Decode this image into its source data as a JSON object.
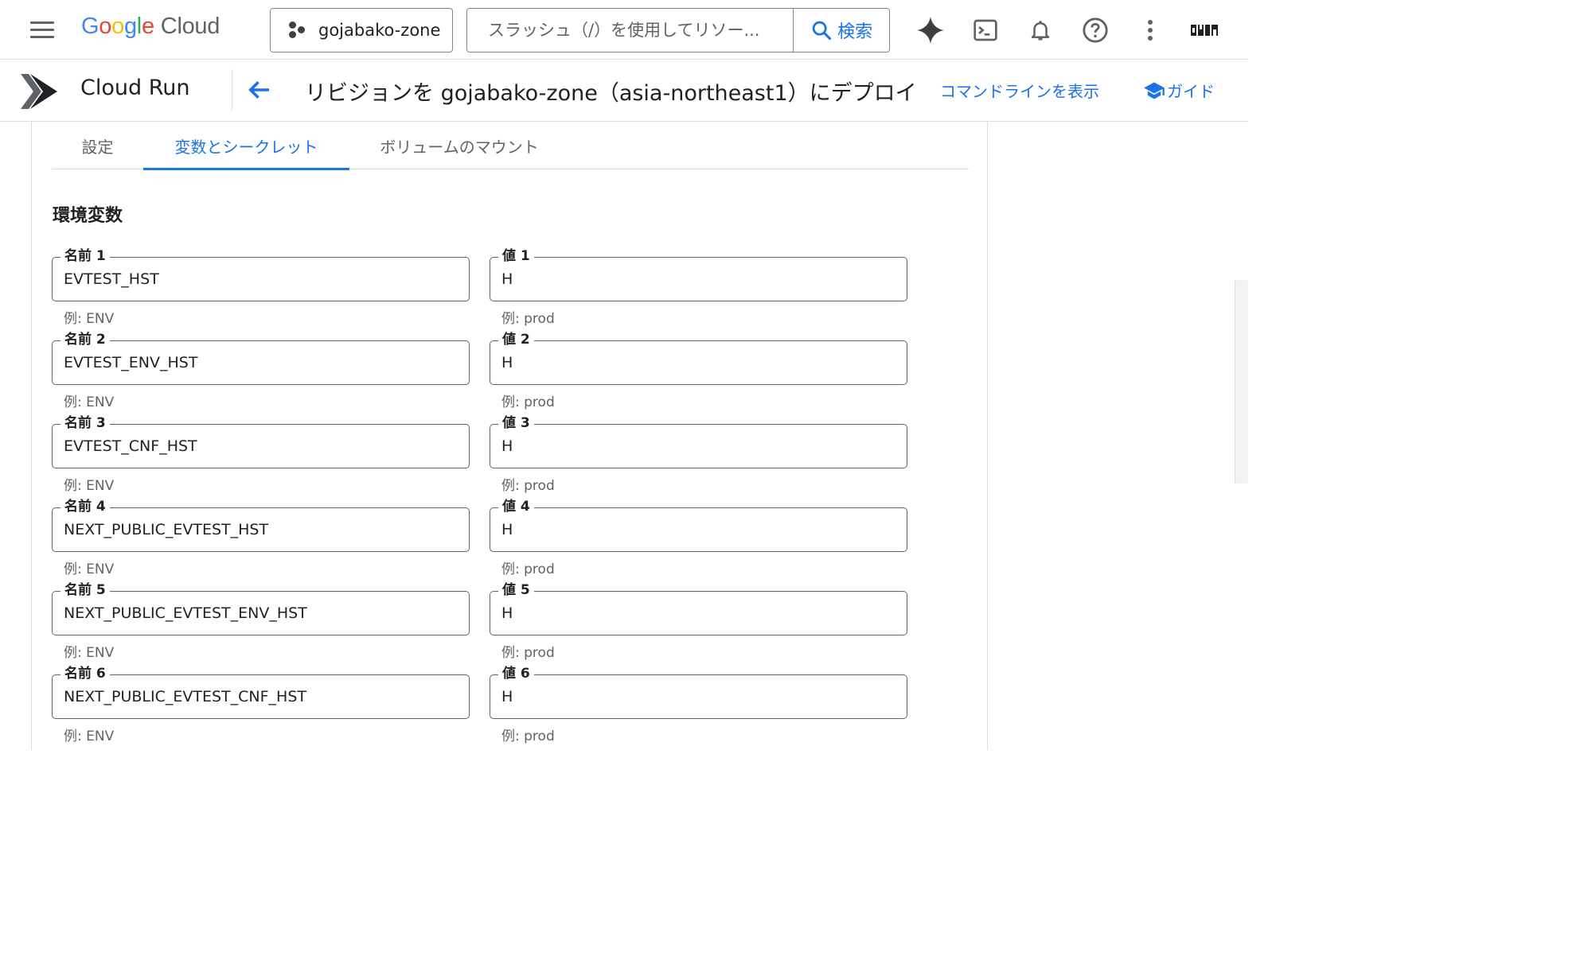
{
  "topbar": {
    "logo_google": "Google",
    "logo_cloud": "Cloud",
    "project": "gojabako-zone",
    "search_placeholder": "スラッシュ（/）を使用してリソー...",
    "search_button": "検索"
  },
  "header": {
    "product": "Cloud Run",
    "title": "リビジョンを gojabako-zone（asia-northeast1）にデプロイ",
    "cmd_link": "コマンドラインを表示",
    "guide_link": "ガイド"
  },
  "tabs": [
    "設定",
    "変数とシークレット",
    "ボリュームのマウント"
  ],
  "section_title": "環境変数",
  "env_vars": [
    {
      "name_label": "名前 1",
      "name": "EVTEST_HST",
      "name_hint": "例: ENV",
      "value_label": "値 1",
      "value": "H",
      "value_hint": "例: prod"
    },
    {
      "name_label": "名前 2",
      "name": "EVTEST_ENV_HST",
      "name_hint": "例: ENV",
      "value_label": "値 2",
      "value": "H",
      "value_hint": "例: prod"
    },
    {
      "name_label": "名前 3",
      "name": "EVTEST_CNF_HST",
      "name_hint": "例: ENV",
      "value_label": "値 3",
      "value": "H",
      "value_hint": "例: prod"
    },
    {
      "name_label": "名前 4",
      "name": "NEXT_PUBLIC_EVTEST_HST",
      "name_hint": "例: ENV",
      "value_label": "値 4",
      "value": "H",
      "value_hint": "例: prod"
    },
    {
      "name_label": "名前 5",
      "name": "NEXT_PUBLIC_EVTEST_ENV_HST",
      "name_hint": "例: ENV",
      "value_label": "値 5",
      "value": "H",
      "value_hint": "例: prod"
    },
    {
      "name_label": "名前 6",
      "name": "NEXT_PUBLIC_EVTEST_CNF_HST",
      "name_hint": "例: ENV",
      "value_label": "値 6",
      "value": "H",
      "value_hint": "例: prod"
    }
  ],
  "colors": {
    "accent": "#1a73e8",
    "google_blue": "#4285f4",
    "google_red": "#ea4335",
    "google_yellow": "#fbbc05",
    "google_green": "#34a853"
  }
}
